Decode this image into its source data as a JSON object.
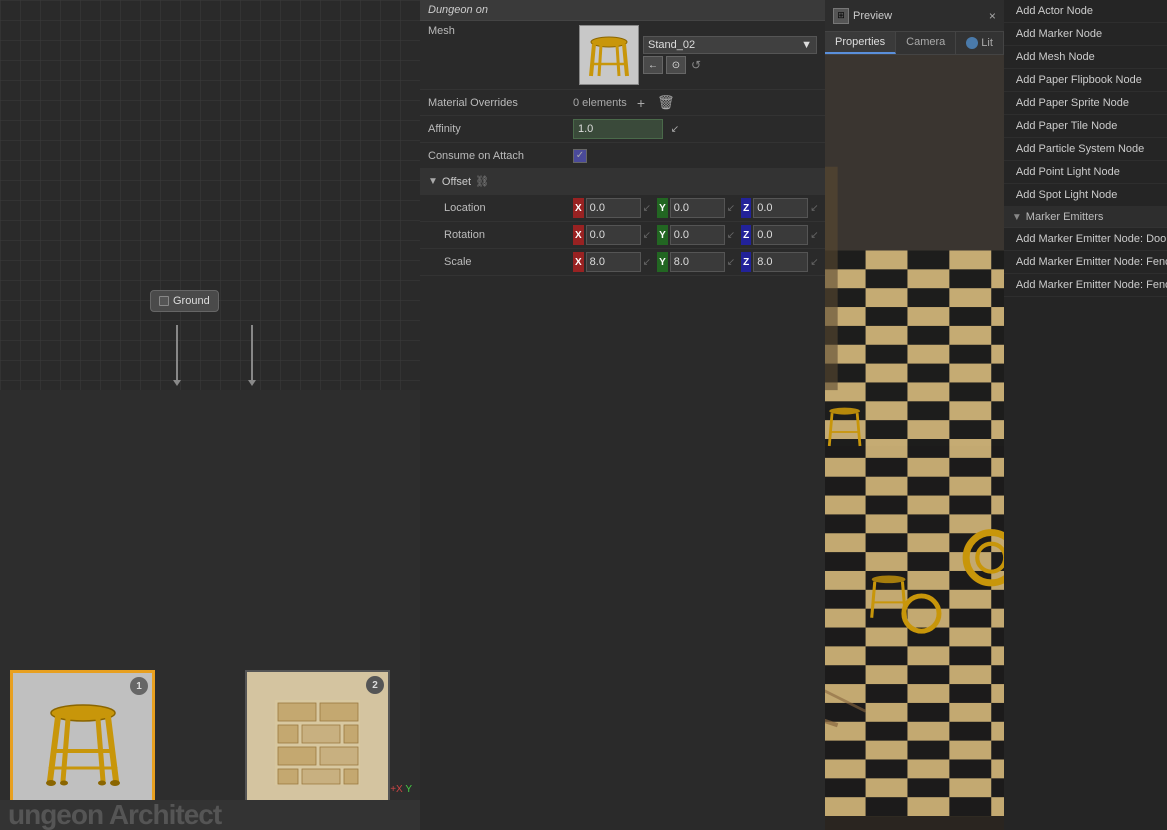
{
  "leftPanel": {
    "groundNode": {
      "label": "Ground"
    },
    "nodeThumb1": {
      "badge": "1",
      "selected": true
    },
    "nodeThumb2": {
      "badge": "2",
      "selected": false
    },
    "bottomText": "ungeon Architect"
  },
  "propertiesPanel": {
    "header": "Dungeon on",
    "meshLabel": "Mesh",
    "meshValue": "Stand_02",
    "materialOverridesLabel": "Material Overrides",
    "materialOverridesValue": "0 elements",
    "affinityLabel": "Affinity",
    "affinityValue": "1.0",
    "consumeOnAttachLabel": "Consume on Attach",
    "offsetLabel": "Offset",
    "locationLabel": "Location",
    "locationX": "0.0",
    "locationY": "0.0",
    "locationZ": "0.0",
    "rotationLabel": "Rotation",
    "rotationX": "0.0",
    "rotationY": "0.0",
    "rotationZ": "0.0",
    "scaleLabel": "Scale",
    "scaleX": "8.0",
    "scaleY": "8.0",
    "scaleZ": "8.0"
  },
  "previewPanel": {
    "title": "Preview",
    "closeBtn": "×",
    "tabs": {
      "properties": "Properties",
      "camera": "Camera",
      "lit": "Lit"
    }
  },
  "addNodesPanel": {
    "items": [
      {
        "label": "Add Actor Node",
        "id": "add-actor-node"
      },
      {
        "label": "Add Marker Node",
        "id": "add-marker-node"
      },
      {
        "label": "Add Mesh Node",
        "id": "add-mesh-node"
      },
      {
        "label": "Add Paper Flipbook Node",
        "id": "add-paper-flipbook-node"
      },
      {
        "label": "Add Paper Sprite Node",
        "id": "add-paper-sprite-node"
      },
      {
        "label": "Add Paper Tile Node",
        "id": "add-paper-tile-node"
      },
      {
        "label": "Add Particle System Node",
        "id": "add-particle-system-node"
      },
      {
        "label": "Add Point Light Node",
        "id": "add-point-light-node"
      },
      {
        "label": "Add Spot Light Node",
        "id": "add-spot-light-node"
      }
    ],
    "markerEmittersSection": {
      "label": "Marker Emitters",
      "items": [
        {
          "label": "Add Marker Emitter Node: Door",
          "id": "add-marker-emitter-door"
        },
        {
          "label": "Add Marker Emitter Node: Fence",
          "id": "add-marker-emitter-fence"
        },
        {
          "label": "Add Marker Emitter Node: FenceSeparator",
          "id": "add-marker-emitter-fenceseparator"
        }
      ]
    }
  },
  "icons": {
    "chevronDown": "▼",
    "chevronRight": "▶",
    "triangleDown": "▼",
    "triangleRight": "▶",
    "plus": "+",
    "trash": "🗑",
    "back": "←",
    "search": "🔍",
    "reset": "↺",
    "checkmark": "✓",
    "squareIcon": "□",
    "gridIcon": "⊞"
  }
}
